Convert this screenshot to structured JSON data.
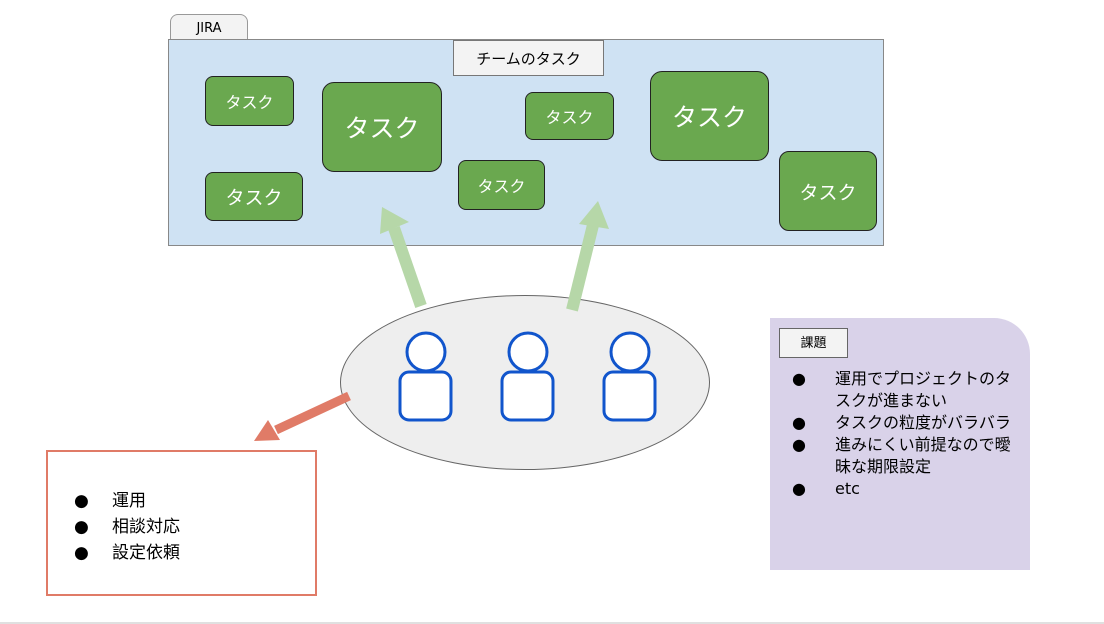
{
  "tab": {
    "label": "JIRA"
  },
  "board": {
    "title": "チームのタスク",
    "tasks": [
      "タスク",
      "タスク",
      "タスク",
      "タスク",
      "タスク",
      "タスク",
      "タスク",
      "タスク"
    ]
  },
  "ops": {
    "items": [
      "運用",
      "相談対応",
      "設定依頼"
    ]
  },
  "issues": {
    "title": "課題",
    "items": [
      "運用でプロジェクトのタスクが進まない",
      "タスクの粒度がバラバラ",
      "進みにくい前提なので曖昧な期限設定",
      "etc"
    ]
  },
  "bullet": "●",
  "colors": {
    "board_bg": "#cfe2f3",
    "task_green": "#6aa84f",
    "arrow_green": "#b6d7a8",
    "arrow_red": "#e07b67",
    "person_blue": "#1155cc",
    "issues_bg": "#d9d2e9"
  }
}
